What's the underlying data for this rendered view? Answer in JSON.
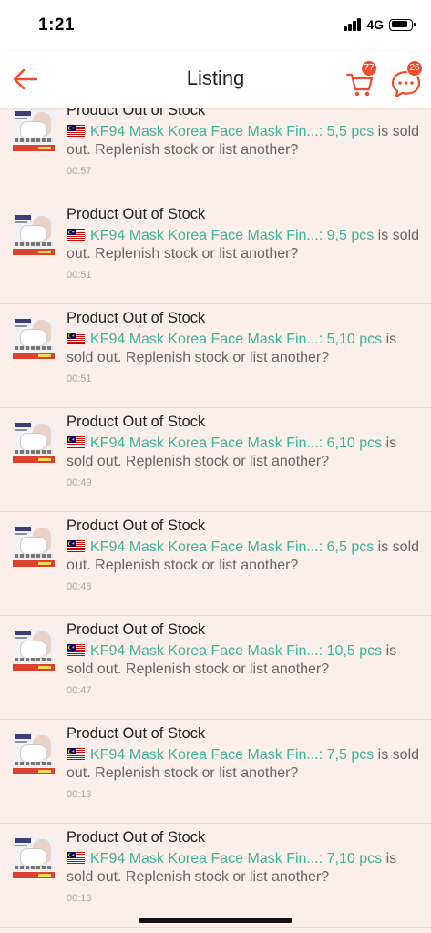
{
  "status_bar": {
    "time": "1:21",
    "network": "4G"
  },
  "header": {
    "title": "Listing",
    "back_icon": "arrow-left-icon",
    "cart_icon": "cart-icon",
    "chat_icon": "chat-icon",
    "cart_badge": "77",
    "chat_badge": "26"
  },
  "colors": {
    "brand": "#ee4d2d",
    "link": "#3fb39d",
    "background": "#fcefe9"
  },
  "notifications": [
    {
      "title": "Product Out of Stock",
      "product": "KF94 Mask Korea Face Mask Fin...: 5,5 pcs",
      "message": " is sold out. Replenish stock or list another?",
      "time": "00:57"
    },
    {
      "title": "Product Out of Stock",
      "product": "KF94 Mask Korea Face Mask Fin...: 9,5 pcs",
      "message": " is sold out. Replenish stock or list another?",
      "time": "00:51"
    },
    {
      "title": "Product Out of Stock",
      "product": "KF94 Mask Korea Face Mask Fin...: 5,10 pcs",
      "message": " is sold out. Replenish stock or list another?",
      "time": "00:51"
    },
    {
      "title": "Product Out of Stock",
      "product": "KF94 Mask Korea Face Mask Fin...: 6,10 pcs",
      "message": " is sold out. Replenish stock or list another?",
      "time": "00:49"
    },
    {
      "title": "Product Out of Stock",
      "product": "KF94 Mask Korea Face Mask Fin...: 6,5 pcs",
      "message": " is sold out. Replenish stock or list another?",
      "time": "00:48"
    },
    {
      "title": "Product Out of Stock",
      "product": "KF94 Mask Korea Face Mask Fin...: 10,5 pcs",
      "message": " is sold out. Replenish stock or list another?",
      "time": "00:47"
    },
    {
      "title": "Product Out of Stock",
      "product": "KF94 Mask Korea Face Mask Fin...: 7,5 pcs",
      "message": " is sold out. Replenish stock or list another?",
      "time": "00:13"
    },
    {
      "title": "Product Out of Stock",
      "product": "KF94 Mask Korea Face Mask Fin...: 7,10 pcs",
      "message": " is sold out. Replenish stock or list another?",
      "time": "00:13"
    }
  ]
}
